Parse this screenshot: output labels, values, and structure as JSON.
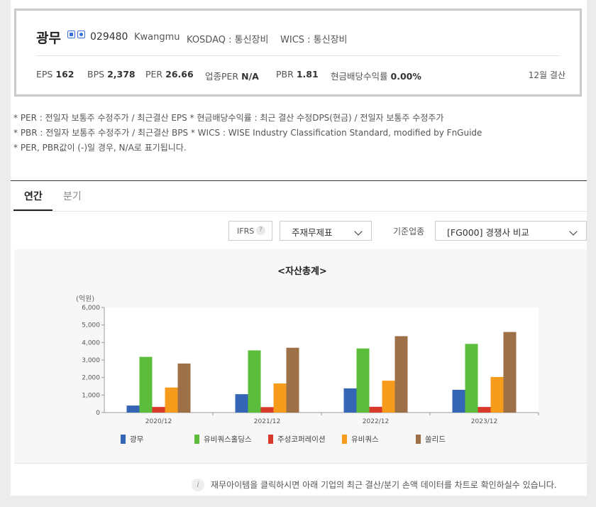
{
  "company": {
    "name": "광무",
    "code": "029480",
    "english_name": "Kwangmu",
    "market": "KOSDAQ : 통신장비",
    "wics": "WICS : 통신장비",
    "badges": [
      "home-icon",
      "phone-icon"
    ]
  },
  "metrics": [
    {
      "label": "EPS",
      "value": "162"
    },
    {
      "label": "BPS",
      "value": "2,378"
    },
    {
      "label": "PER",
      "value": "26.66"
    },
    {
      "label": "업종PER",
      "value": "N/A"
    },
    {
      "label": "PBR",
      "value": "1.81"
    },
    {
      "label": "현금배당수익률",
      "value": "0.00%"
    }
  ],
  "settlement": "12월 결산",
  "notes": [
    "* PER : 전일자 보통주 수정주가 / 최근결산 EPS * 현금배당수익률 : 최근 결산 수정DPS(현금) / 전일자 보통주 수정주가",
    "* PBR : 전일자 보통주 수정주가 / 최근결산 BPS * WICS : WISE Industry Classification Standard, modified by FnGuide",
    "* PER, PBR값이 (-)일 경우, N/A로 표기됩니다."
  ],
  "tabs": [
    "연간",
    "분기"
  ],
  "controls": {
    "ifrs_label": "IFRS",
    "ifrs_help": "?",
    "statement_select": "주재무제표",
    "base_label": "기준업종",
    "peer_select": "[FG000] 경쟁사 비교"
  },
  "footer_info": "재무아이템을 클릭하시면 아래 기업의 최근 결산/분기 손액 데이터를 차트로 확인하실수 있습니다.",
  "colors": {
    "s0": "#3566b5",
    "s1": "#5cbd3c",
    "s2": "#d9392a",
    "s3": "#f79b1c",
    "s4": "#9e7048"
  },
  "chart_data": {
    "type": "bar",
    "title": "<자산총계>",
    "unit": "(억원)",
    "categories": [
      "2020/12",
      "2021/12",
      "2022/12",
      "2023/12"
    ],
    "ylim": [
      0,
      6000
    ],
    "yticks": [
      "0",
      "1,000",
      "2,000",
      "3,000",
      "4,000",
      "5,000",
      "6,000"
    ],
    "series": [
      {
        "name": "광무",
        "values": [
          400,
          1050,
          1380,
          1300
        ]
      },
      {
        "name": "유비쿼스홀딩스",
        "values": [
          3180,
          3550,
          3660,
          3920
        ]
      },
      {
        "name": "주성코퍼레이션",
        "values": [
          320,
          310,
          330,
          320
        ]
      },
      {
        "name": "유비쿼스",
        "values": [
          1430,
          1660,
          1820,
          2030
        ]
      },
      {
        "name": "쏠리드",
        "values": [
          2800,
          3700,
          4360,
          4600
        ]
      }
    ],
    "legend_position": "bottom",
    "grid": false
  }
}
